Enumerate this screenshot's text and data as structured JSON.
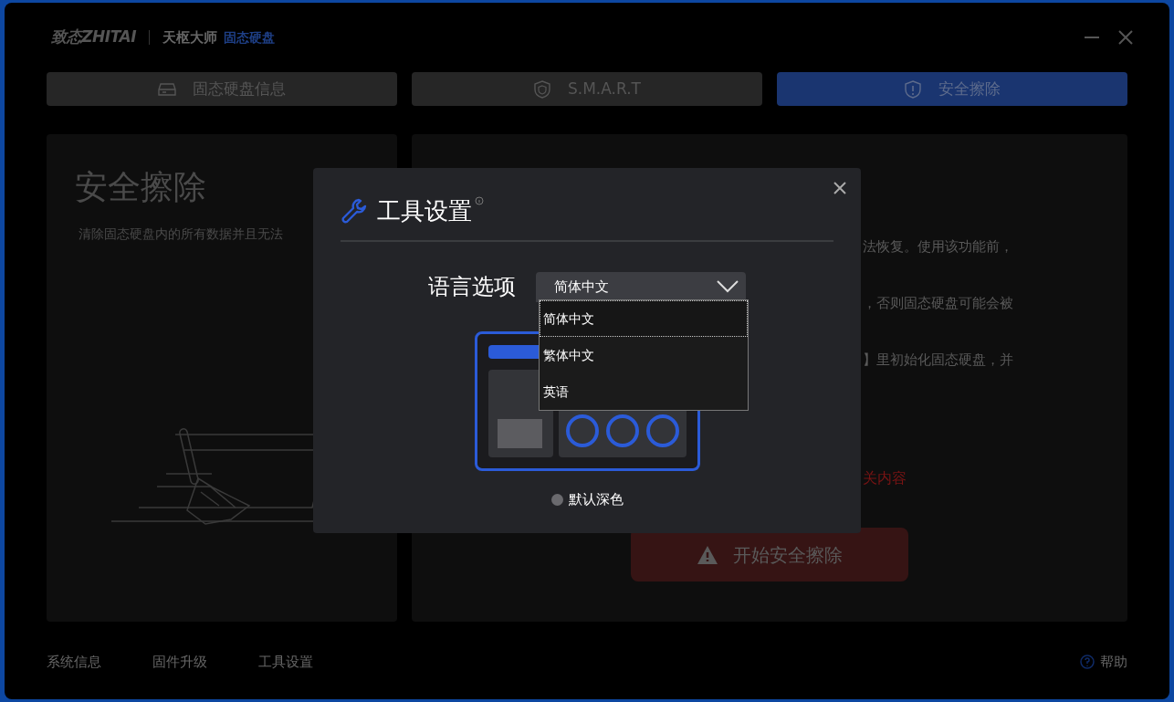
{
  "app": {
    "logo": "致态ZHITAI",
    "product": "天枢大师",
    "product_tag": "固态硬盘"
  },
  "tabs": [
    {
      "label": "固态硬盘信息",
      "kind": "drive",
      "selected": false
    },
    {
      "label": "S.M.A.R.T",
      "kind": "shield",
      "selected": false
    },
    {
      "label": "安全擦除",
      "kind": "alert-shield",
      "selected": true
    }
  ],
  "left_panel": {
    "title": "安全擦除",
    "description": "清除固态硬盘内的所有数据并且无法"
  },
  "right_panel": {
    "lines": [
      "法恢复。使用该功能前，",
      "，否则固态硬盘可能会被",
      "】里初始化固态硬盘，并"
    ],
    "warning": "关内容",
    "start_button": "开始安全擦除"
  },
  "footer_links": [
    "系统信息",
    "固件升级",
    "工具设置"
  ],
  "help": "帮助",
  "dialog": {
    "title": "工具设置",
    "language_label": "语言选项",
    "language_value": "简体中文",
    "expanded": true,
    "options": [
      {
        "label": "简体中文",
        "selected": true
      },
      {
        "label": "繁体中文",
        "selected": false
      },
      {
        "label": "英语",
        "selected": false
      }
    ],
    "theme_label": "默认深色",
    "theme_selected": false
  }
}
